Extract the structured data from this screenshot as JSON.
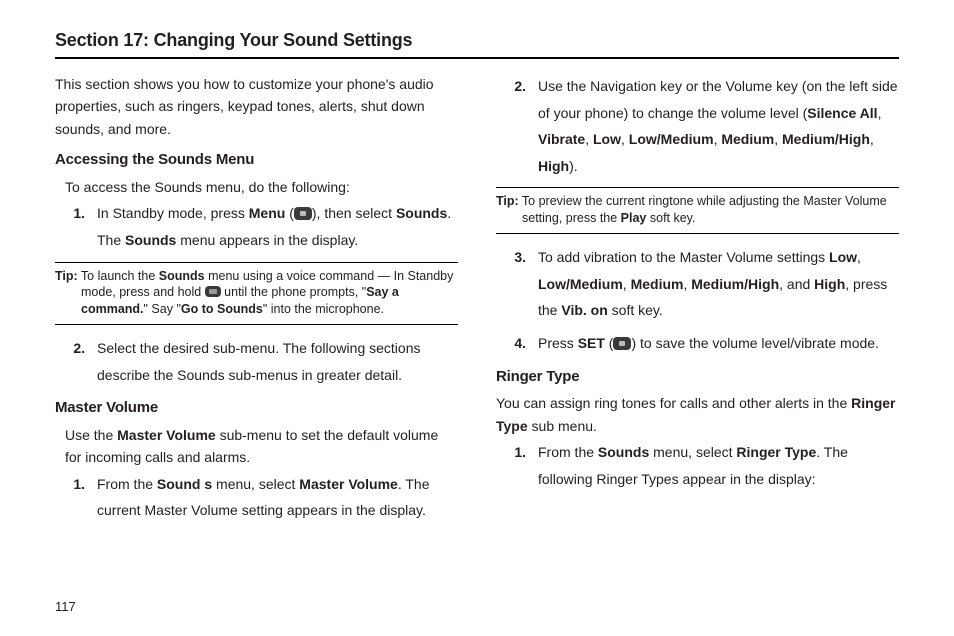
{
  "section_title": "Section 17: Changing Your Sound Settings",
  "page_number": "117",
  "left": {
    "intro": "This section shows you how to customize your phone's audio properties, such as ringers, keypad tones, alerts, shut down sounds, and more.",
    "h_access": "Accessing the Sounds Menu",
    "access_lead": "To access the Sounds menu, do the following:",
    "step1_a": "In Standby mode, press ",
    "step1_menu": "Menu",
    "step1_b": " (",
    "step1_c": "), then select ",
    "step1_sounds": "Sounds",
    "step1_d": ". The ",
    "step1_sounds2": "Sounds",
    "step1_e": " menu appears in the display.",
    "tip1_label": "Tip:",
    "tip1_a": " To launch the ",
    "tip1_sounds": "Sounds",
    "tip1_b": " menu using a voice command — In Standby mode, press and hold ",
    "tip1_c": " until the phone prompts, \"",
    "tip1_say": "Say a command.",
    "tip1_d": "\" Say \"",
    "tip1_go": "Go to Sounds",
    "tip1_e": "\" into the microphone.",
    "step2": "Select the desired sub-menu. The following sections describe the Sounds sub-menus in greater detail.",
    "h_master": "Master Volume",
    "master_lead_a": "Use the ",
    "master_lead_mv": "Master Volume",
    "master_lead_b": " sub-menu to set the default volume for incoming calls and alarms.",
    "mv_step1_a": "From the ",
    "mv_step1_sounds": "Sound s",
    "mv_step1_b": " menu, select ",
    "mv_step1_mv": "Master Volume",
    "mv_step1_c": ". The current Master Volume setting appears in the display."
  },
  "right": {
    "step2_a": "Use the Navigation key or the Volume key (on the left side of your phone) to change the volume level (",
    "lv_silence": "Silence All",
    "lv_vibrate": "Vibrate",
    "lv_low": "Low",
    "lv_lowmed": "Low/Medium",
    "lv_medium": "Medium",
    "lv_medhigh": "Medium/High",
    "lv_high": "High",
    "step2_b": ").",
    "tip2_label": "Tip:",
    "tip2_a": " To preview the current ringtone while adjusting the Master Volume setting, press the ",
    "tip2_play": "Play",
    "tip2_b": " soft key.",
    "step3_a": "To add vibration to the Master Volume settings ",
    "step3_b": ", and ",
    "step3_c": ", press the ",
    "step3_vib": "Vib. on",
    "step3_d": " soft key.",
    "step4_a": "Press ",
    "step4_set": "SET",
    "step4_b": " (",
    "step4_c": ") to save the volume level/vibrate mode.",
    "h_ringer": "Ringer Type",
    "ringer_lead_a": "You can assign ring tones for calls and other alerts in the ",
    "ringer_lead_rt": "Ringer Type",
    "ringer_lead_b": " sub menu.",
    "rt_step1_a": "From the ",
    "rt_step1_sounds": "Sounds",
    "rt_step1_b": " menu, select ",
    "rt_step1_rt": "Ringer Type",
    "rt_step1_c": ". The following Ringer Types appear in the display:"
  },
  "nums": {
    "n1": "1.",
    "n2": "2.",
    "n3": "3.",
    "n4": "4."
  },
  "comma": ", "
}
